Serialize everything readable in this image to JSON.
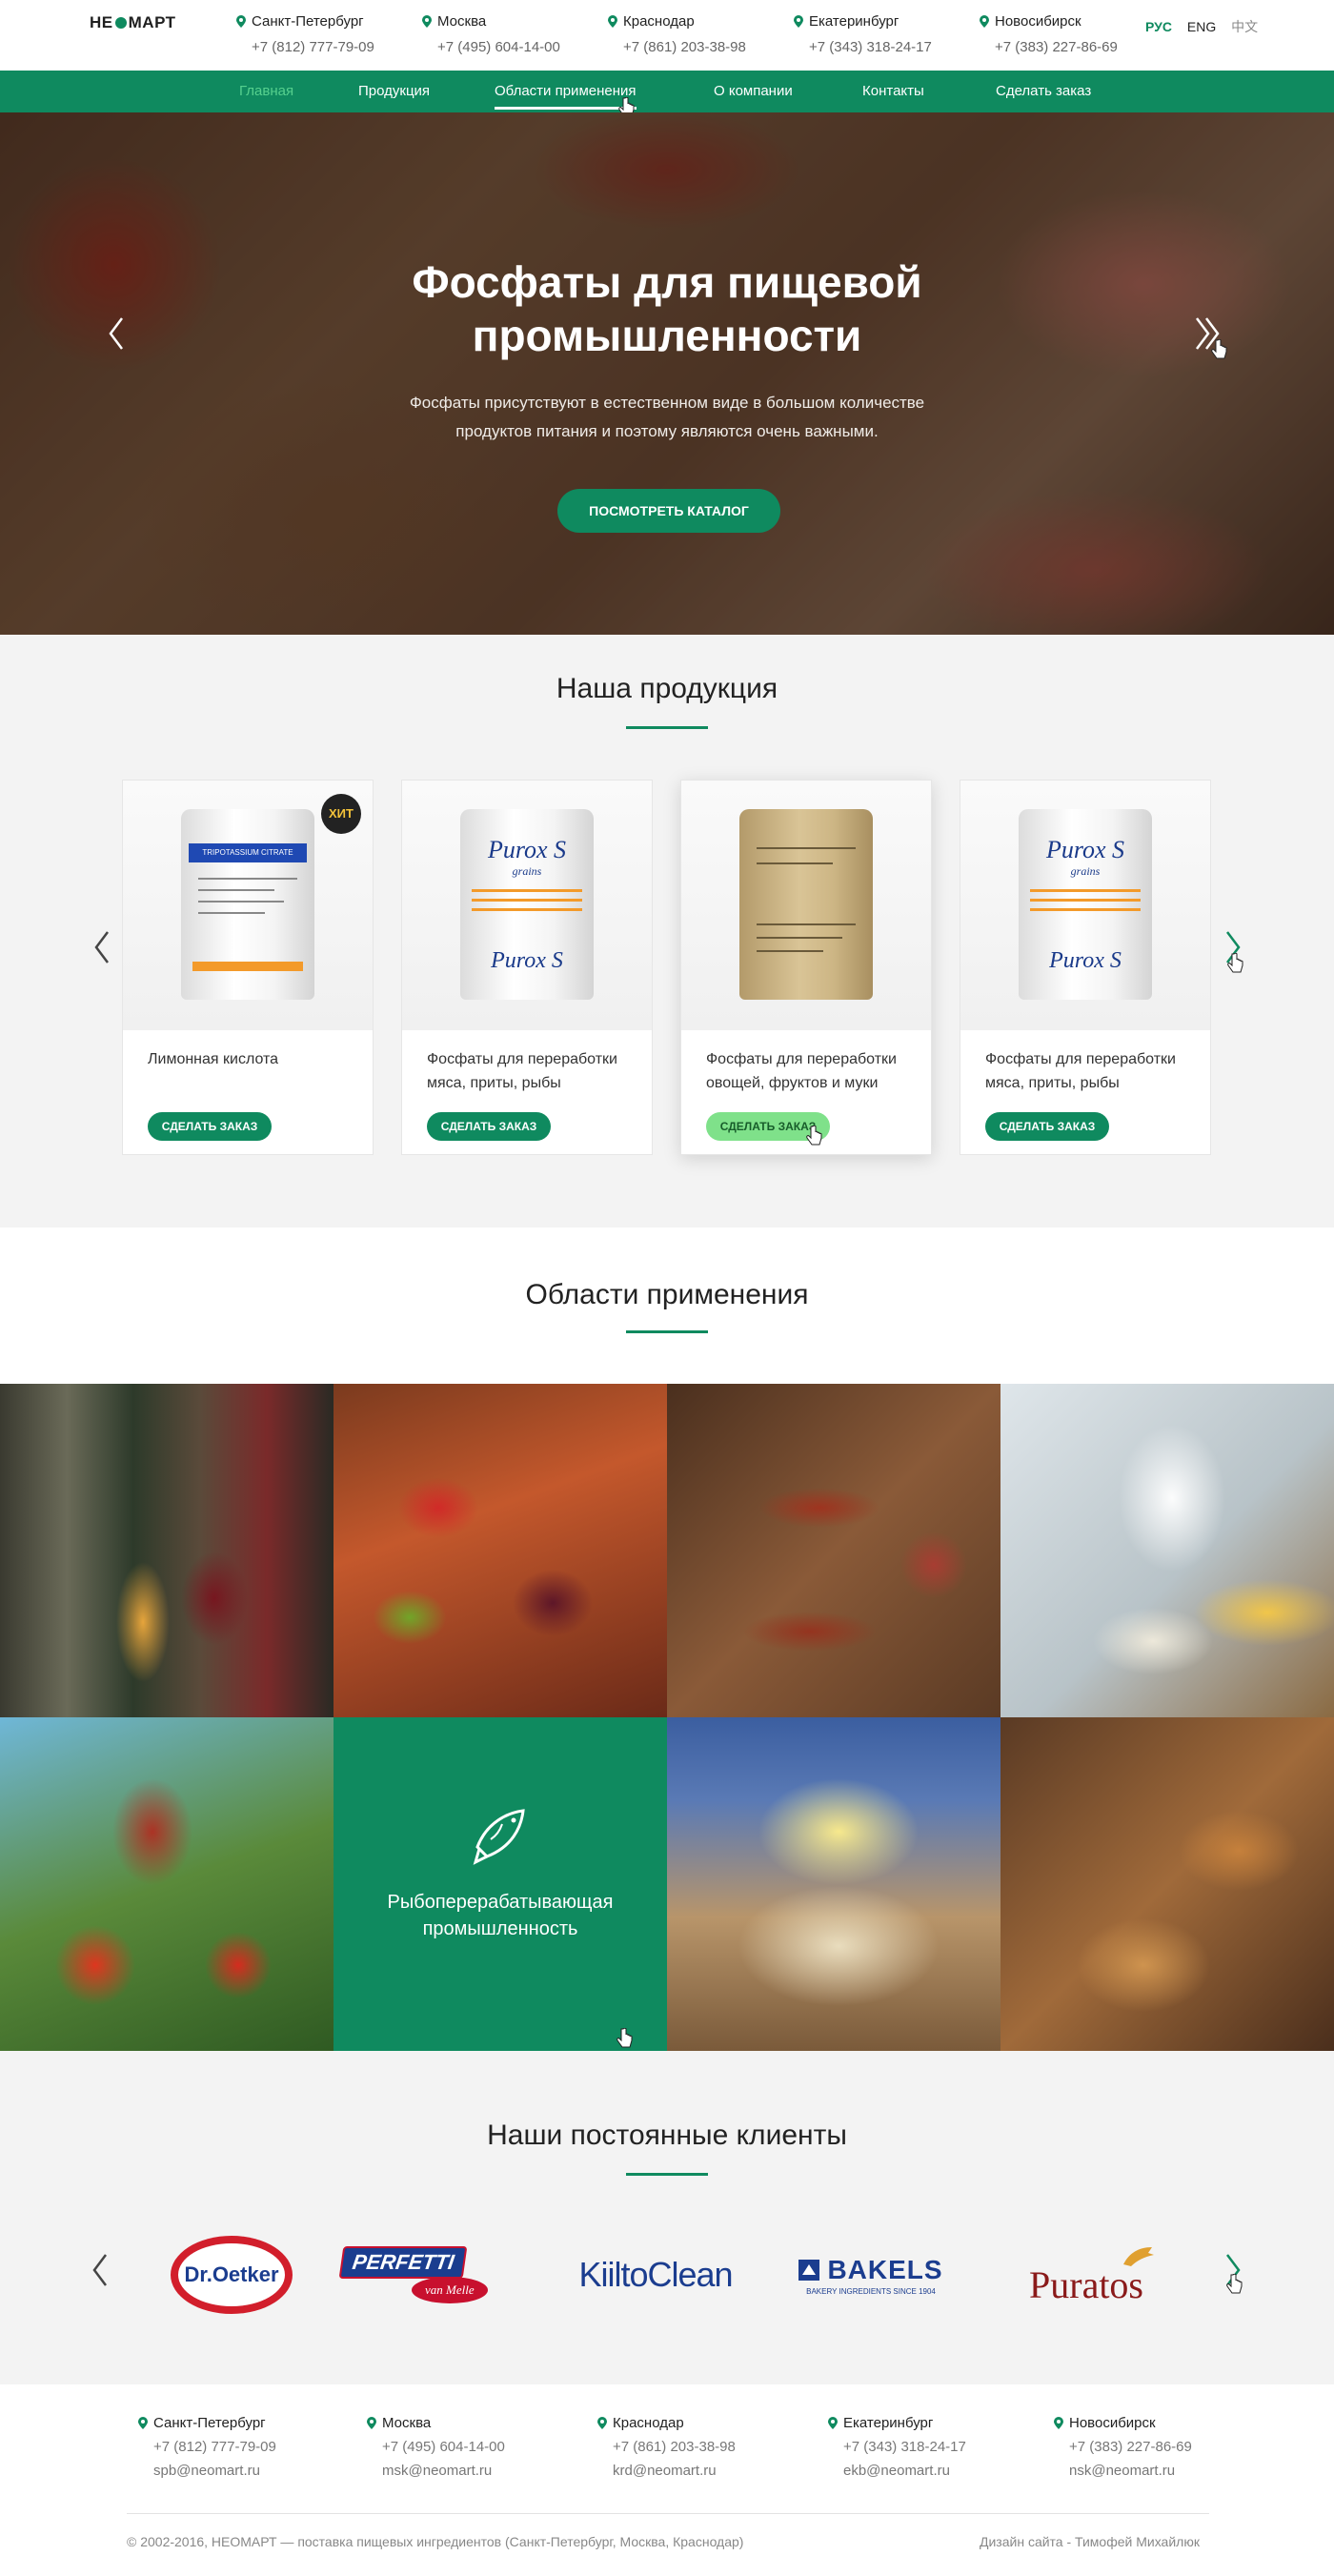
{
  "header": {
    "logo_text_left": "НЕ",
    "logo_text_right": "МАРТ",
    "cities": [
      {
        "name": "Санкт-Петербург",
        "phone": "+7 (812) 777-79-09"
      },
      {
        "name": "Москва",
        "phone": "+7 (495) 604-14-00"
      },
      {
        "name": "Краснодар",
        "phone": "+7 (861) 203-38-98"
      },
      {
        "name": "Екатеринбург",
        "phone": "+7 (343) 318-24-17"
      },
      {
        "name": "Новосибирск",
        "phone": "+7 (383) 227-86-69"
      }
    ],
    "languages": [
      "РУС",
      "ENG",
      "中文"
    ]
  },
  "nav": {
    "items": [
      "Главная",
      "Продукция",
      "Области применения",
      "О компании",
      "Контакты",
      "Сделать заказ"
    ]
  },
  "hero": {
    "title_line1": "Фосфаты для пищевой",
    "title_line2": "промышленности",
    "text_line1": "Фосфаты присутствуют в естественном виде в большом количестве",
    "text_line2": "продуктов питания и поэтому являются очень важными.",
    "button": "ПОСМОТРЕТЬ КАТАЛОГ"
  },
  "products": {
    "title": "Наша продукция",
    "badge": "ХИТ",
    "order_button": "СДЕЛАТЬ ЗАКАЗ",
    "items": [
      {
        "name_line1": "Лимонная кислота",
        "name_line2": "",
        "bag_label": "TRIPOTASSIUM CITRATE"
      },
      {
        "name_line1": "Фосфаты для переработки",
        "name_line2": "мяса, приты, рыбы",
        "bag_brand": "Purox S",
        "bag_sub": "grains"
      },
      {
        "name_line1": "Фосфаты для переработки",
        "name_line2": "овощей, фруктов и муки"
      },
      {
        "name_line1": "Фосфаты для переработки",
        "name_line2": "мяса, приты, рыбы",
        "bag_brand": "Purox S",
        "bag_sub": "grains"
      }
    ]
  },
  "applications": {
    "title": "Области применения",
    "highlight_label_line1": "Рыбоперерабатывающая",
    "highlight_label_line2": "промышленность"
  },
  "clients": {
    "title": "Наши постоянные клиенты",
    "logos": [
      "Dr.Oetker",
      "PERFETTI",
      "van Melle",
      "KiiltoClean",
      "BAKELS",
      "BAKERY INGREDIENTS SINCE 1904",
      "Puratos"
    ]
  },
  "footer": {
    "offices": [
      {
        "name": "Санкт-Петербург",
        "phone": "+7 (812) 777-79-09",
        "email": "spb@neomart.ru"
      },
      {
        "name": "Москва",
        "phone": "+7 (495) 604-14-00",
        "email": "msk@neomart.ru"
      },
      {
        "name": "Краснодар",
        "phone": "+7 (861) 203-38-98",
        "email": "krd@neomart.ru"
      },
      {
        "name": "Екатеринбург",
        "phone": "+7 (343) 318-24-17",
        "email": "ekb@neomart.ru"
      },
      {
        "name": "Новосибирск",
        "phone": "+7 (383) 227-86-69",
        "email": "nsk@neomart.ru"
      }
    ],
    "copyright": "© 2002-2016, НЕОМАРТ — поставка пищевых  ингредиентов (Санкт-Петербург, Москва, Краснодар)",
    "design": "Дизайн сайта - Тимофей Михайлюк"
  },
  "colors": {
    "brand_green": "#0f8a5f",
    "active_nav": "#56d08e",
    "hover_button": "#7fe18a"
  }
}
